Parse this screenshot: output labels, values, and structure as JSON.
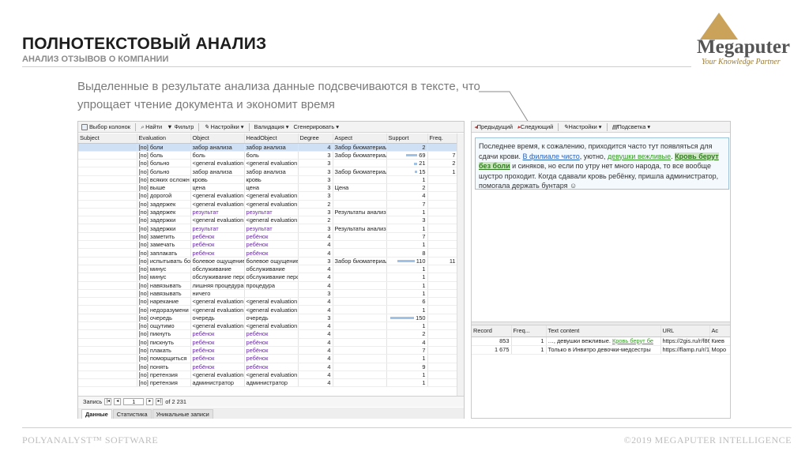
{
  "slide": {
    "title": "ПОЛНОТЕКСТОВЫЙ АНАЛИЗ",
    "subtitle": "АНАЛИЗ ОТЗЫВОВ О КОМПАНИИ",
    "description": "Выделенные в результате анализа данные подсвечиваются в тексте, что упрощает чтение документа и экономит время",
    "logo_brand": "Megaputer",
    "logo_tagline": "Your Knowledge Partner",
    "footer_left": "POLYANALYST™ SOFTWARE",
    "footer_right": "©2019 MEGAPUTER INTELLIGENCE"
  },
  "left_toolbar": {
    "select_columns": "Выбор колонок",
    "find": "Найти",
    "filter": "Фильтр",
    "settings": "Настройки",
    "validation": "Валидация",
    "generate": "Сгенерировать"
  },
  "grid": {
    "headers": [
      "Subject",
      "Evaluation",
      "Object",
      "HeadObject",
      "Degree",
      "Aspect",
      "Support",
      "Freq."
    ],
    "rows": [
      [
        "",
        "[no] боли",
        "забор анализа",
        "забор анализа",
        "4",
        "Забор биоматериал",
        "2",
        ""
      ],
      [
        "",
        "[no] боль",
        "боль",
        "боль",
        "3",
        "Забор биоматериал",
        "69",
        "7"
      ],
      [
        "",
        "[no] больно",
        "<general evaluation",
        "<general evaluation",
        "3",
        "",
        "21",
        "2"
      ],
      [
        "",
        "[no] больно",
        "забор анализа",
        "забор анализа",
        "3",
        "Забор биоматериал",
        "15",
        "1"
      ],
      [
        "",
        "[no] всяких осложн",
        "кровь",
        "кровь",
        "3",
        "",
        "1",
        ""
      ],
      [
        "",
        "[no] выше",
        "цена",
        "цена",
        "3",
        "Цена",
        "2",
        ""
      ],
      [
        "",
        "[no] дорогой",
        "<general evaluation",
        "<general evaluation",
        "3",
        "",
        "4",
        ""
      ],
      [
        "",
        "[no] задержек",
        "<general evaluation",
        "<general evaluation",
        "2",
        "",
        "7",
        ""
      ],
      [
        "",
        "[no] задержек",
        "результат",
        "результат",
        "3",
        "Результаты анализ",
        "1",
        ""
      ],
      [
        "",
        "[no] задержки",
        "<general evaluation",
        "<general evaluation",
        "2",
        "",
        "3",
        ""
      ],
      [
        "",
        "[no] задержки",
        "результат",
        "результат",
        "3",
        "Результаты анализ",
        "1",
        ""
      ],
      [
        "",
        "[no] заметить",
        "ребёнок",
        "ребёнок",
        "4",
        "",
        "7",
        ""
      ],
      [
        "",
        "[no] замечать",
        "ребёнок",
        "ребёнок",
        "4",
        "",
        "1",
        ""
      ],
      [
        "",
        "[no] заплакать",
        "ребёнок",
        "ребёнок",
        "4",
        "",
        "8",
        ""
      ],
      [
        "",
        "[no] испытывать бо",
        "болевое ощущение",
        "болевое ощущение",
        "3",
        "Забор биоматериал",
        "110",
        "11"
      ],
      [
        "",
        "[no] минус",
        "обслуживание",
        "обслуживание",
        "4",
        "",
        "1",
        ""
      ],
      [
        "",
        "[no] минус",
        "обслуживание перс",
        "обслуживание перс",
        "4",
        "",
        "1",
        ""
      ],
      [
        "",
        "[no] навязывать",
        "лишняя процедура",
        "процедура",
        "4",
        "",
        "1",
        ""
      ],
      [
        "",
        "[no] навязывать",
        "ничего",
        "",
        "3",
        "",
        "1",
        ""
      ],
      [
        "",
        "[no] нарекание",
        "<general evaluation",
        "<general evaluation",
        "4",
        "",
        "6",
        ""
      ],
      [
        "",
        "[no] недоразумени",
        "<general evaluation",
        "<general evaluation",
        "4",
        "",
        "1",
        ""
      ],
      [
        "",
        "[no] очередь",
        "очередь",
        "очередь",
        "3",
        "",
        "150",
        ""
      ],
      [
        "",
        "[no] ощутимо",
        "<general evaluation",
        "<general evaluation",
        "4",
        "",
        "1",
        ""
      ],
      [
        "",
        "[no] пикнуть",
        "ребёнок",
        "ребёнок",
        "4",
        "",
        "2",
        ""
      ],
      [
        "",
        "[no] пискнуть",
        "ребёнок",
        "ребёнок",
        "4",
        "",
        "4",
        ""
      ],
      [
        "",
        "[no] плакать",
        "ребёнок",
        "ребёнок",
        "4",
        "",
        "7",
        ""
      ],
      [
        "",
        "[no] поморщиться",
        "ребёнок",
        "ребёнок",
        "4",
        "",
        "1",
        ""
      ],
      [
        "",
        "[no] понять",
        "ребёнок",
        "ребёнок",
        "4",
        "",
        "9",
        ""
      ],
      [
        "",
        "[no] претензия",
        "<general evaluation",
        "<general evaluation",
        "4",
        "",
        "1",
        ""
      ],
      [
        "",
        "[no] претензия",
        "администратор",
        "администратор",
        "4",
        "",
        "1",
        ""
      ]
    ],
    "purple_rows": [
      8,
      10,
      11,
      12,
      13,
      23,
      24,
      25,
      26,
      27
    ],
    "record_label": "Запись",
    "record_value": "1",
    "record_total": "of 2 231",
    "tabs": [
      "Данные",
      "Статистика",
      "Уникальные записи"
    ]
  },
  "right_toolbar": {
    "prev": "Предыдущий",
    "next": "Следующий",
    "settings": "Настройки",
    "highlight": "Подсветка"
  },
  "document": {
    "p1": "Последнее время, к сожалению, приходится часто тут появляться для сдачи крови. ",
    "link1": "В филиале чисто",
    "p2": ", уютно, ",
    "link2": "девушки вежливые",
    "p3": ".",
    "strong": "Кровь берут без боли",
    "p4": " и синяков, но если по утру нет много народа, то все вообще шустро проходит. Когда сдавали кровь ребёнку, пришла администратор, помогала держать бунтаря ☺"
  },
  "bottom_grid": {
    "headers": [
      "Record",
      "Freq...",
      "Text content",
      "URL",
      "Ac"
    ],
    "rows": [
      {
        "record": "853",
        "freq": "1",
        "text_prefix": "…, девушки вежливые. ",
        "text_mark": "Кровь берут бе",
        "url": "https://2gis.ru/r/f86",
        "extra": "Киев"
      },
      {
        "record": "1 675",
        "freq": "1",
        "text_prefix": "Только в Инвитро девочки-медсестры",
        "text_mark": "",
        "url": "https://flamp.ru/r/1",
        "extra": "Моро"
      }
    ]
  }
}
